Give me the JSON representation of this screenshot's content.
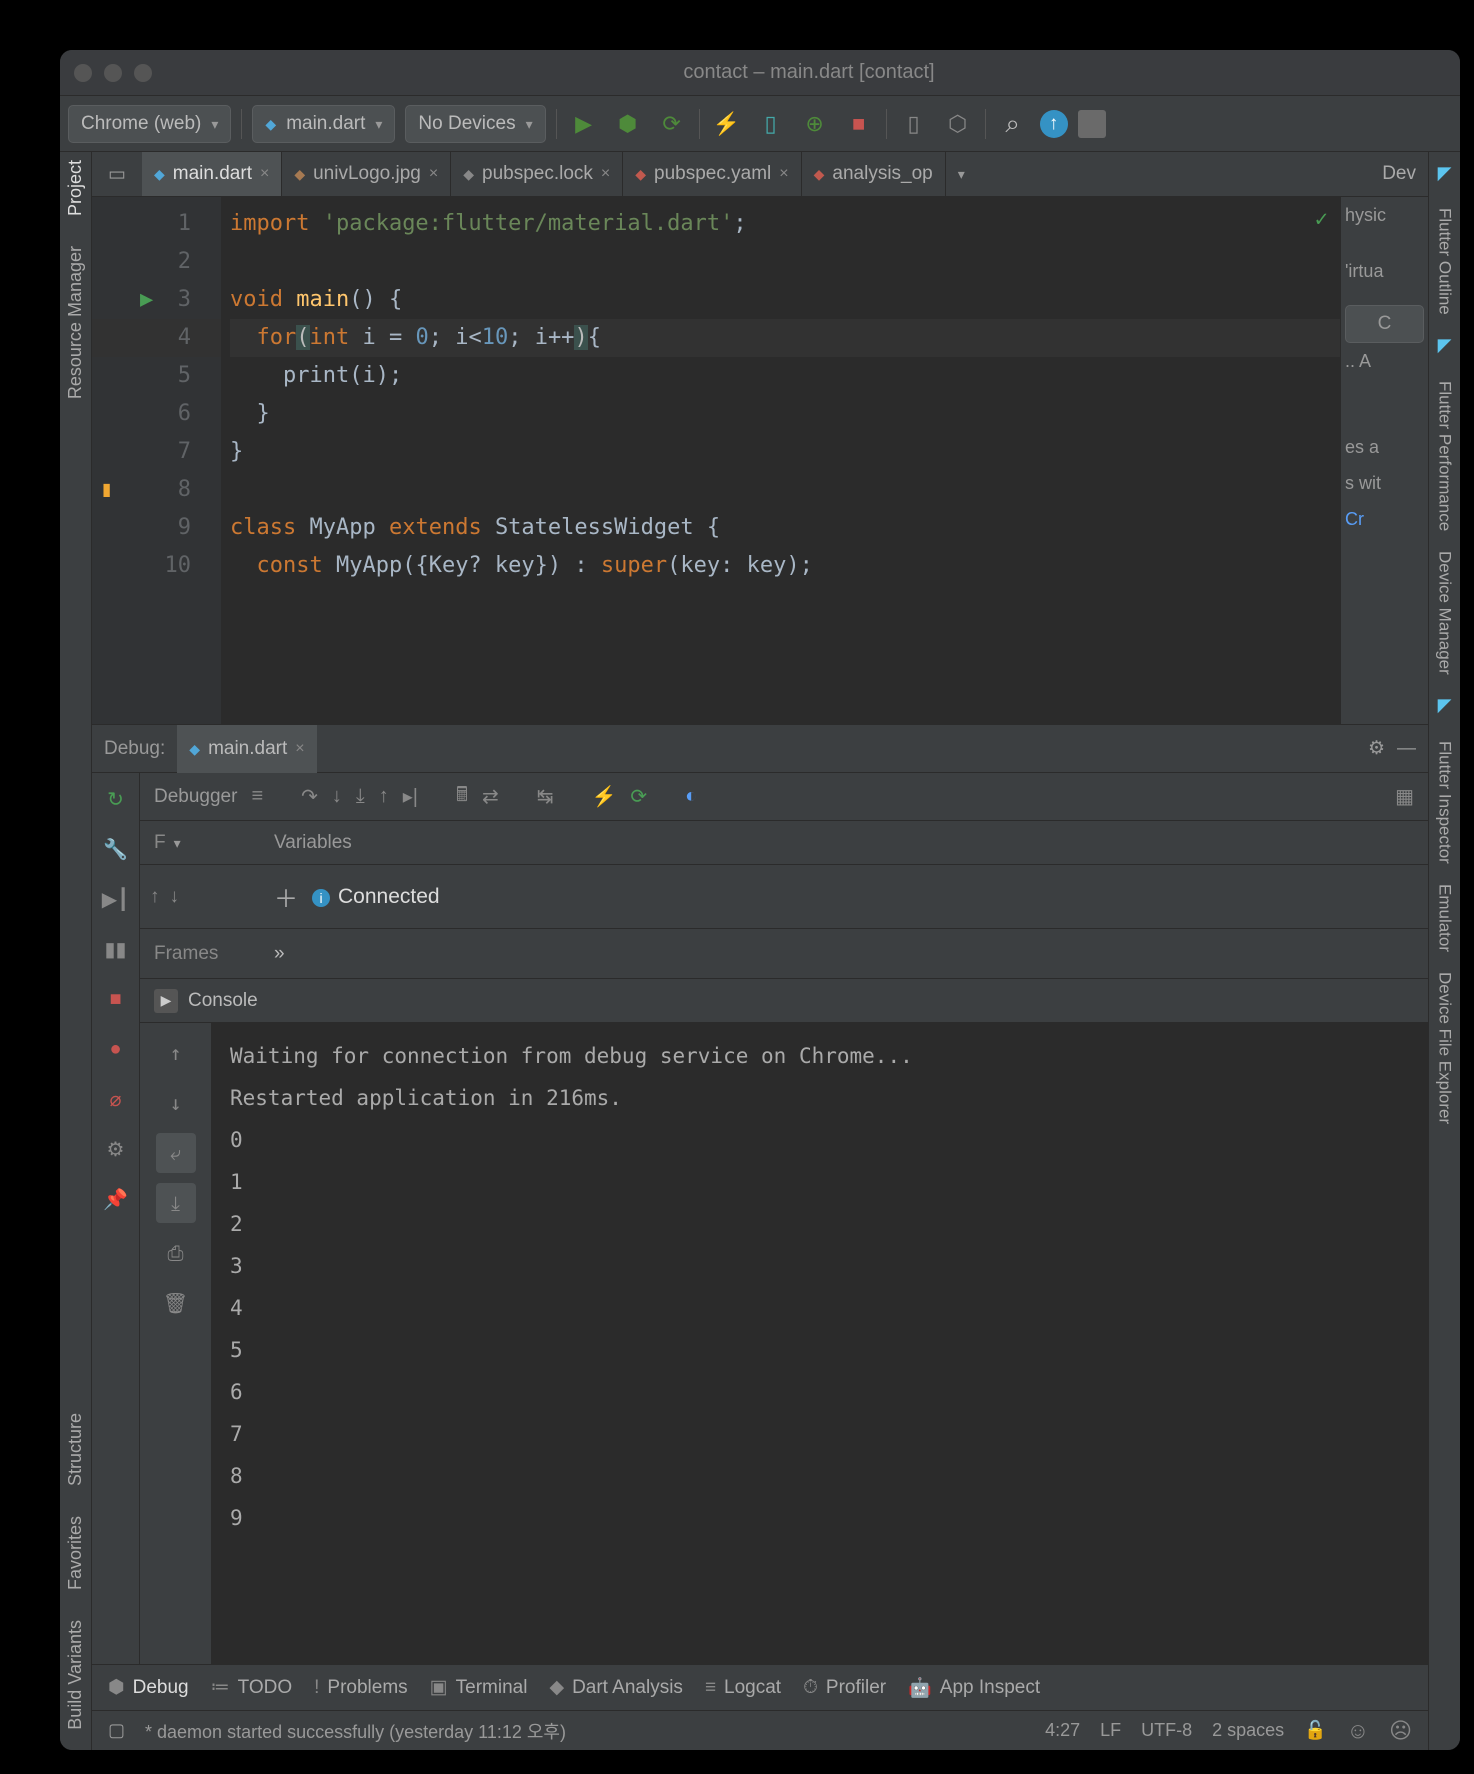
{
  "title": "contact – main.dart [contact]",
  "toolbar": {
    "target": "Chrome (web)",
    "config": "main.dart",
    "devices": "No Devices"
  },
  "leftrail": {
    "project": "Project",
    "resmgr": "Resource Manager",
    "structure": "Structure",
    "favorites": "Favorites",
    "variants": "Build Variants"
  },
  "rightrail": {
    "outline": "Flutter Outline",
    "perf": "Flutter Performance",
    "devmgr": "Device Manager",
    "inspector": "Flutter Inspector",
    "emulator": "Emulator",
    "filex": "Device File Explorer"
  },
  "tabs": [
    {
      "name": "main.dart",
      "active": true,
      "icon": "dart"
    },
    {
      "name": "univLogo.jpg",
      "active": false,
      "icon": "img"
    },
    {
      "name": "pubspec.lock",
      "active": false,
      "icon": "lock"
    },
    {
      "name": "pubspec.yaml",
      "active": false,
      "icon": "yaml"
    },
    {
      "name": "analysis_op",
      "active": false,
      "icon": "yaml"
    }
  ],
  "devtab": "Dev",
  "rightpanel": {
    "line1": "hysic",
    "line2": "'irtua",
    "btn": "C",
    "line3": ".. A",
    "line4": "es a",
    "line5": "s wit",
    "line6": "Cr"
  },
  "code": {
    "lines": [
      1,
      2,
      3,
      4,
      5,
      6,
      7,
      8,
      9,
      10
    ],
    "tokens": {
      "import": "import ",
      "pkg": "'package:flutter/material.dart'",
      "semi": ";",
      "void": "void ",
      "main": "main",
      "lp": "() {",
      "for": "for",
      "forcond": "int i = 0; i<10; i++",
      "brace": "{",
      "print": "print(i);",
      "rb": "}",
      "class": "class ",
      "myapp": "MyApp ",
      "extends": "extends ",
      "sw": "StatelessWidget {",
      "const": "const ",
      "ctor": "MyApp({Key? key}) : ",
      "super": "super",
      "superarg": "(key: key);",
      "ten": "10"
    }
  },
  "debug": {
    "label": "Debug:",
    "tab": "main.dart",
    "debugger": "Debugger",
    "framesHdr": "F",
    "variablesHdr": "Variables",
    "connected": "Connected",
    "frames": "Frames",
    "consoleHdr": "Console",
    "output": [
      "Waiting for connection from debug service on Chrome...",
      "Restarted application in 216ms.",
      "0",
      "1",
      "2",
      "3",
      "4",
      "5",
      "6",
      "7",
      "8",
      "9"
    ]
  },
  "bottombar": {
    "debug": "Debug",
    "todo": "TODO",
    "problems": "Problems",
    "terminal": "Terminal",
    "dart": "Dart Analysis",
    "logcat": "Logcat",
    "profiler": "Profiler",
    "appinsp": "App Inspect"
  },
  "status": {
    "msg": "* daemon started successfully (yesterday 11:12 오후)",
    "pos": "4:27",
    "lf": "LF",
    "enc": "UTF-8",
    "indent": "2 spaces"
  }
}
